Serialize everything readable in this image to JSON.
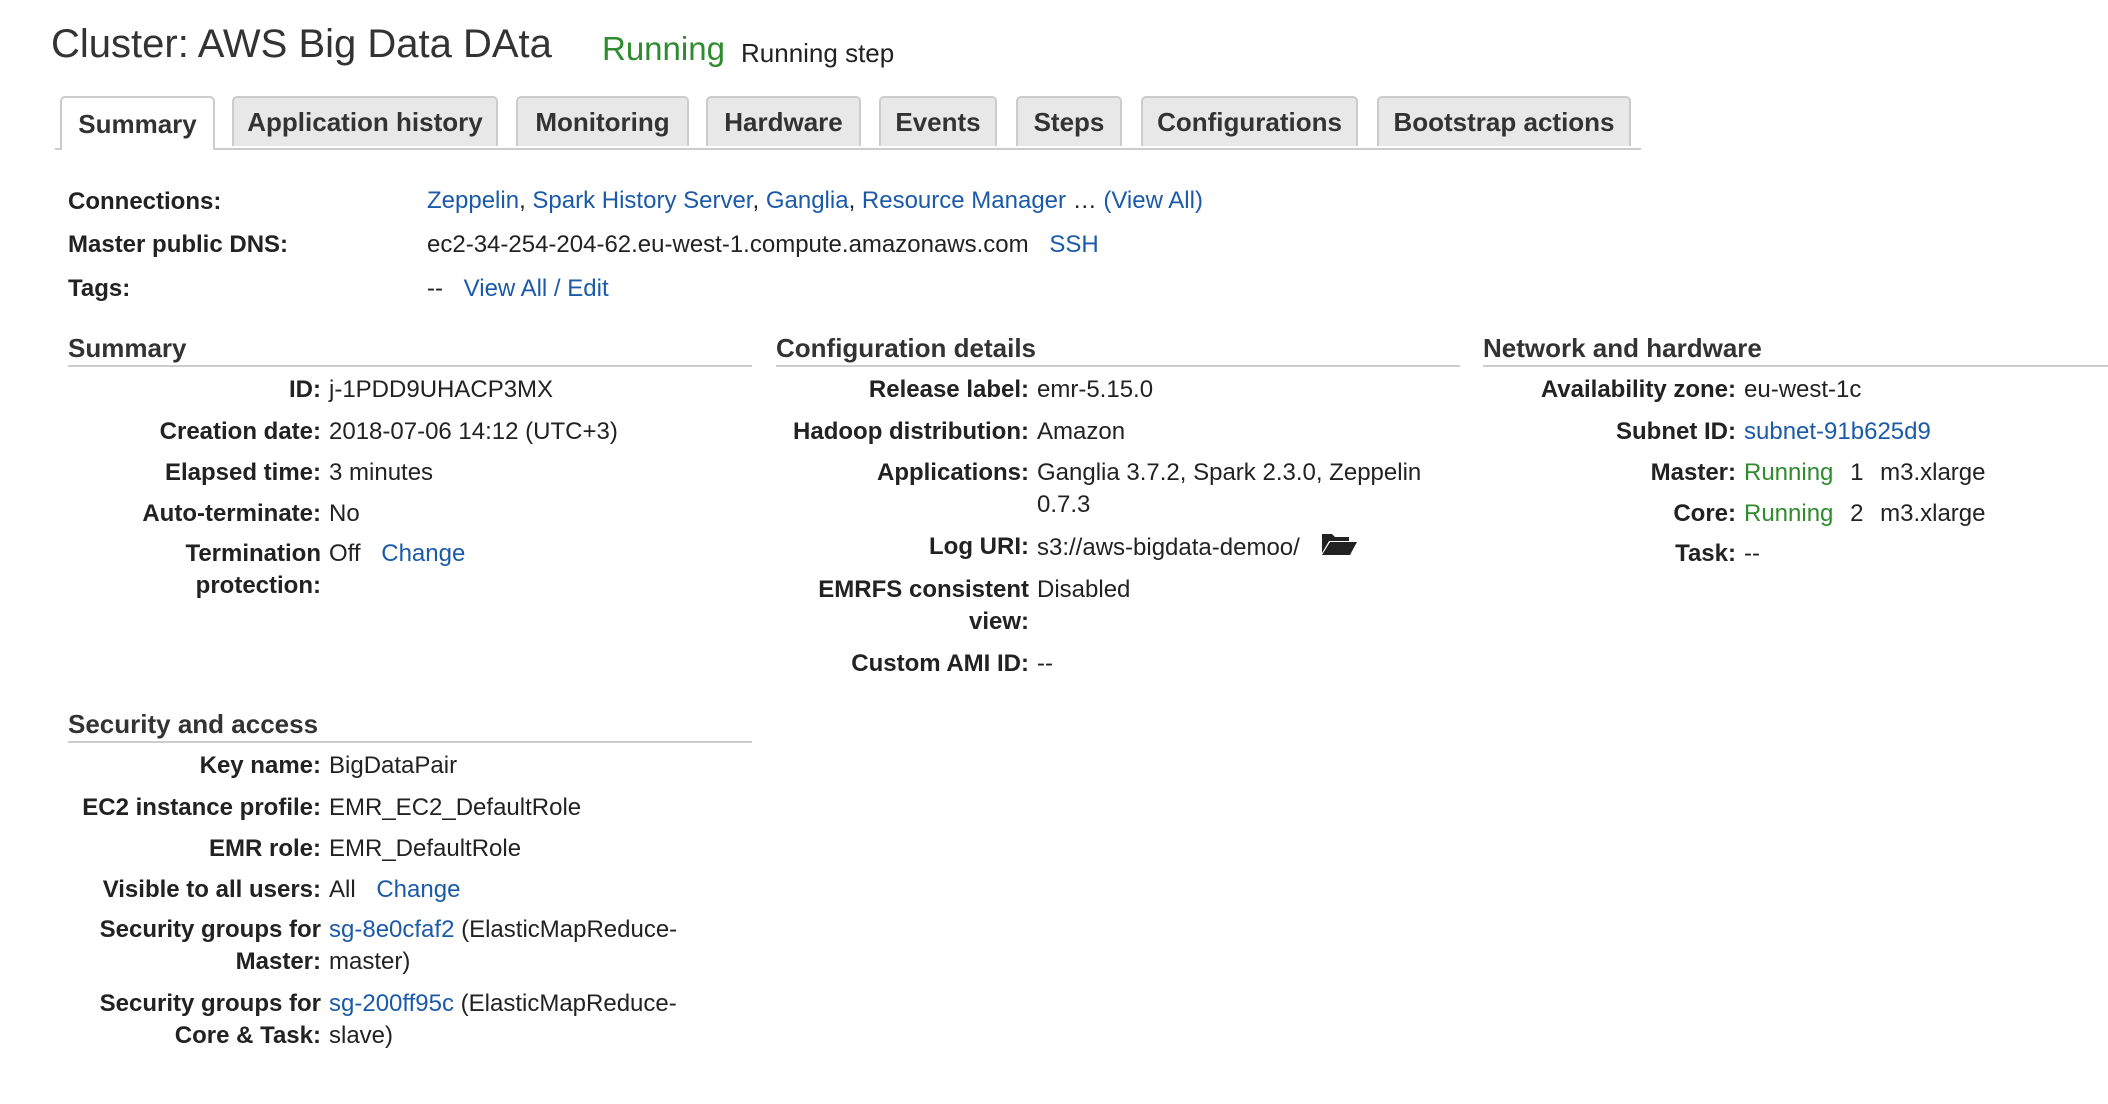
{
  "header": {
    "title": "Cluster: AWS Big Data DAta",
    "state": "Running",
    "state_detail": "Running step"
  },
  "tabs": [
    {
      "label": "Summary",
      "active": true
    },
    {
      "label": "Application history"
    },
    {
      "label": "Monitoring"
    },
    {
      "label": "Hardware"
    },
    {
      "label": "Events"
    },
    {
      "label": "Steps"
    },
    {
      "label": "Configurations"
    },
    {
      "label": "Bootstrap actions"
    }
  ],
  "top": {
    "connections_label": "Connections:",
    "connections": [
      "Zeppelin",
      "Spark History Server",
      "Ganglia",
      "Resource Manager"
    ],
    "connections_sep": ",",
    "connections_ellipsis": "…",
    "connections_view_all": "(View All)",
    "dns_label": "Master public DNS:",
    "dns_value": "ec2-34-254-204-62.eu-west-1.compute.amazonaws.com",
    "ssh_link": "SSH",
    "tags_label": "Tags:",
    "tags_value": "--",
    "tags_link": "View All / Edit"
  },
  "summary": {
    "title": "Summary",
    "id_label": "ID:",
    "id_value": "j-1PDD9UHACP3MX",
    "creation_label": "Creation date:",
    "creation_value": "2018-07-06 14:12 (UTC+3)",
    "elapsed_label": "Elapsed time:",
    "elapsed_value": "3 minutes",
    "autoterm_label": "Auto-terminate:",
    "autoterm_value": "No",
    "termprot_label_1": "Termination",
    "termprot_label_2": "protection:",
    "termprot_value": "Off",
    "termprot_link": "Change"
  },
  "config": {
    "title": "Configuration details",
    "release_label": "Release label:",
    "release_value": "emr-5.15.0",
    "hadoop_label": "Hadoop distribution:",
    "hadoop_value": "Amazon",
    "apps_label": "Applications:",
    "apps_value_1": "Ganglia 3.7.2, Spark 2.3.0, Zeppelin",
    "apps_value_2": "0.7.3",
    "loguri_label": "Log URI:",
    "loguri_value": "s3://aws-bigdata-demoo/",
    "emrfs_label_1": "EMRFS consistent",
    "emrfs_label_2": "view:",
    "emrfs_value": "Disabled",
    "ami_label": "Custom AMI ID:",
    "ami_value": "--"
  },
  "network": {
    "title": "Network and hardware",
    "az_label": "Availability zone:",
    "az_value": "eu-west-1c",
    "subnet_label": "Subnet ID:",
    "subnet_value": "subnet-91b625d9",
    "master_label": "Master:",
    "master_state": "Running",
    "master_count": "1",
    "master_type": "m3.xlarge",
    "core_label": "Core:",
    "core_state": "Running",
    "core_count": "2",
    "core_type": "m3.xlarge",
    "task_label": "Task:",
    "task_value": "--"
  },
  "security": {
    "title": "Security and access",
    "key_label": "Key name:",
    "key_value": "BigDataPair",
    "profile_label": "EC2 instance profile:",
    "profile_value": "EMR_EC2_DefaultRole",
    "role_label": "EMR role:",
    "role_value": "EMR_DefaultRole",
    "visible_label": "Visible to all users:",
    "visible_value": "All",
    "visible_link": "Change",
    "sgm_label_1": "Security groups for",
    "sgm_label_2": "Master:",
    "sgm_link": "sg-8e0cfaf2",
    "sgm_value_1": "(ElasticMapReduce-",
    "sgm_value_2": "master)",
    "sgc_label_1": "Security groups for",
    "sgc_label_2": "Core & Task:",
    "sgc_link": "sg-200ff95c",
    "sgc_value_1": "(ElasticMapReduce-",
    "sgc_value_2": "slave)"
  },
  "icons": {
    "log_folder": "folder-open-icon"
  },
  "colors": {
    "link": "#1a5aa8",
    "running": "#2e8b2e",
    "rule": "#cccccc"
  }
}
